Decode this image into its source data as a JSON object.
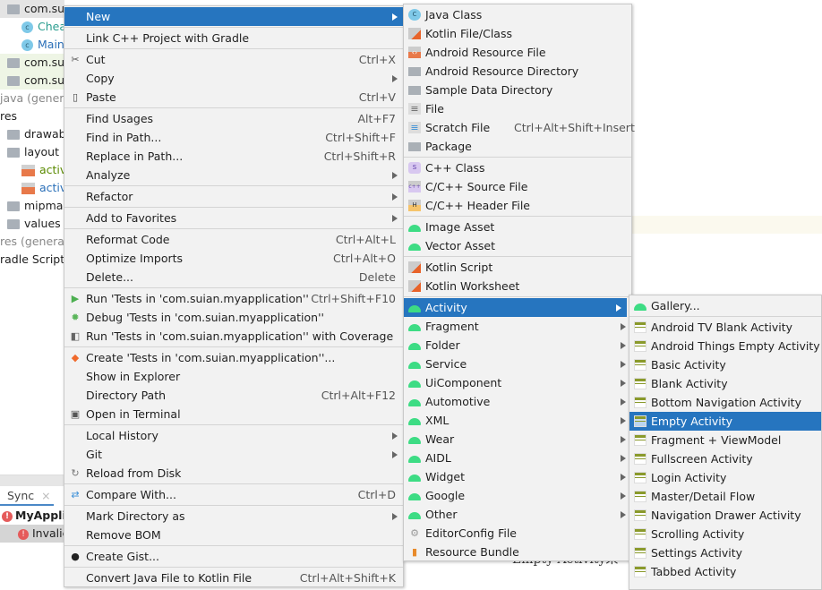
{
  "project_tree": [
    {
      "label": "com.sui",
      "icon": "folder-icon",
      "bg": "#e4e4e4",
      "color": "#1f1f1f"
    },
    {
      "label": "Chea",
      "icon": "class-icon",
      "indent": 1,
      "color": "#2a9d8f"
    },
    {
      "label": "Main",
      "icon": "class-icon",
      "indent": 1,
      "color": "#2a6fb8"
    },
    {
      "label": "com.sui",
      "icon": "folder-icon",
      "bg": "#eef5e5",
      "color": "#1f1f1f"
    },
    {
      "label": "com.sui",
      "icon": "folder-icon",
      "bg": "#eef5e5",
      "color": "#1f1f1f"
    },
    {
      "label": "java (gener",
      "icon": "",
      "color": "#1f1f1f"
    },
    {
      "label": "res",
      "icon": "",
      "color": "#1f1f1f"
    },
    {
      "label": "drawab",
      "icon": "folder-icon",
      "color": "#1f1f1f"
    },
    {
      "label": "layout",
      "icon": "folder-icon",
      "color": "#1f1f1f"
    },
    {
      "label": "activ",
      "icon": "layout-file-icon",
      "indent": 1,
      "color": "#5a8a00"
    },
    {
      "label": "activ",
      "icon": "layout-file-icon",
      "indent": 1,
      "color": "#2a6fb8"
    },
    {
      "label": "mipmap",
      "icon": "folder-icon",
      "color": "#1f1f1f"
    },
    {
      "label": "values",
      "icon": "folder-icon",
      "color": "#1f1f1f"
    },
    {
      "label": "res (genera",
      "icon": "",
      "color": "#1f1f1f"
    },
    {
      "label": "radle Scripts",
      "icon": "",
      "color": "#1f1f1f"
    }
  ],
  "bottom_panel": {
    "tab": "Sync",
    "close": "×",
    "project": "MyAppli",
    "error": "Invalic"
  },
  "behind_text": "Empty Activity来",
  "menus": [
    {
      "id": "context",
      "items": [
        {
          "label": "New",
          "submenu": true,
          "selected": true
        },
        {
          "sep": true
        },
        {
          "label": "Link C++ Project with Gradle"
        },
        {
          "sep": true
        },
        {
          "label": "Cut",
          "shortcut": "Ctrl+X",
          "icon": "scissors-icon"
        },
        {
          "label": "Copy",
          "submenu": true
        },
        {
          "label": "Paste",
          "shortcut": "Ctrl+V",
          "icon": "clipboard-icon"
        },
        {
          "sep": true
        },
        {
          "label": "Find Usages",
          "shortcut": "Alt+F7"
        },
        {
          "label": "Find in Path...",
          "shortcut": "Ctrl+Shift+F"
        },
        {
          "label": "Replace in Path...",
          "shortcut": "Ctrl+Shift+R"
        },
        {
          "label": "Analyze",
          "submenu": true
        },
        {
          "sep": true
        },
        {
          "label": "Refactor",
          "submenu": true
        },
        {
          "sep": true
        },
        {
          "label": "Add to Favorites",
          "submenu": true
        },
        {
          "sep": true
        },
        {
          "label": "Reformat Code",
          "shortcut": "Ctrl+Alt+L"
        },
        {
          "label": "Optimize Imports",
          "shortcut": "Ctrl+Alt+O"
        },
        {
          "label": "Delete...",
          "shortcut": "Delete"
        },
        {
          "sep": true
        },
        {
          "label": "Run 'Tests in 'com.suian.myapplication''",
          "shortcut": "Ctrl+Shift+F10",
          "icon": "run-icon"
        },
        {
          "label": "Debug 'Tests in 'com.suian.myapplication''",
          "icon": "debug-icon"
        },
        {
          "label": "Run 'Tests in 'com.suian.myapplication'' with Coverage",
          "icon": "coverage-icon"
        },
        {
          "sep": true
        },
        {
          "label": "Create 'Tests in 'com.suian.myapplication''...",
          "icon": "create-test-icon"
        },
        {
          "label": "Show in Explorer"
        },
        {
          "label": "Directory Path",
          "shortcut": "Ctrl+Alt+F12"
        },
        {
          "label": "Open in Terminal",
          "icon": "terminal-icon"
        },
        {
          "sep": true
        },
        {
          "label": "Local History",
          "submenu": true
        },
        {
          "label": "Git",
          "submenu": true
        },
        {
          "label": "Reload from Disk",
          "icon": "reload-icon"
        },
        {
          "sep": true
        },
        {
          "label": "Compare With...",
          "shortcut": "Ctrl+D",
          "icon": "compare-icon"
        },
        {
          "sep": true
        },
        {
          "label": "Mark Directory as",
          "submenu": true
        },
        {
          "label": "Remove BOM"
        },
        {
          "sep": true
        },
        {
          "label": "Create Gist...",
          "icon": "github-icon"
        },
        {
          "sep": true
        },
        {
          "label": "Convert Java File to Kotlin File",
          "shortcut": "Ctrl+Alt+Shift+K"
        }
      ]
    },
    {
      "id": "new",
      "items": [
        {
          "label": "Java Class",
          "icon": "java-class-icon"
        },
        {
          "label": "Kotlin File/Class",
          "icon": "kotlin-file-icon"
        },
        {
          "label": "Android Resource File",
          "icon": "resource-file-icon"
        },
        {
          "label": "Android Resource Directory",
          "icon": "folder-icon"
        },
        {
          "label": "Sample Data Directory",
          "icon": "folder-icon"
        },
        {
          "label": "File",
          "icon": "file-icon"
        },
        {
          "label": "Scratch File",
          "shortcut": "Ctrl+Alt+Shift+Insert",
          "icon": "scratch-file-icon"
        },
        {
          "label": "Package",
          "icon": "package-icon"
        },
        {
          "sep": true
        },
        {
          "label": "C++ Class",
          "icon": "cpp-class-icon"
        },
        {
          "label": "C/C++ Source File",
          "icon": "cpp-source-icon"
        },
        {
          "label": "C/C++ Header File",
          "icon": "cpp-header-icon"
        },
        {
          "sep": true
        },
        {
          "label": "Image Asset",
          "icon": "android-icon"
        },
        {
          "label": "Vector Asset",
          "icon": "android-icon"
        },
        {
          "sep": true
        },
        {
          "label": "Kotlin Script",
          "icon": "kotlin-file-icon"
        },
        {
          "label": "Kotlin Worksheet",
          "icon": "kotlin-file-icon"
        },
        {
          "sep": true
        },
        {
          "label": "Activity",
          "submenu": true,
          "selected": true,
          "icon": "android-icon"
        },
        {
          "label": "Fragment",
          "submenu": true,
          "icon": "android-icon"
        },
        {
          "label": "Folder",
          "submenu": true,
          "icon": "android-icon"
        },
        {
          "label": "Service",
          "submenu": true,
          "icon": "android-icon"
        },
        {
          "label": "UiComponent",
          "submenu": true,
          "icon": "android-icon"
        },
        {
          "label": "Automotive",
          "submenu": true,
          "icon": "android-icon"
        },
        {
          "label": "XML",
          "submenu": true,
          "icon": "android-icon"
        },
        {
          "label": "Wear",
          "submenu": true,
          "icon": "android-icon"
        },
        {
          "label": "AIDL",
          "submenu": true,
          "icon": "android-icon"
        },
        {
          "label": "Widget",
          "submenu": true,
          "icon": "android-icon"
        },
        {
          "label": "Google",
          "submenu": true,
          "icon": "android-icon"
        },
        {
          "label": "Other",
          "submenu": true,
          "icon": "android-icon"
        },
        {
          "label": "EditorConfig File",
          "icon": "gear-icon"
        },
        {
          "label": "Resource Bundle",
          "icon": "resource-bundle-icon"
        }
      ]
    },
    {
      "id": "activity",
      "items": [
        {
          "label": "Gallery...",
          "icon": "android-icon"
        },
        {
          "sep": true
        },
        {
          "label": "Android TV Blank Activity",
          "icon": "template-icon"
        },
        {
          "label": "Android Things Empty Activity",
          "icon": "template-icon"
        },
        {
          "label": "Basic Activity",
          "icon": "template-icon"
        },
        {
          "label": "Blank Activity",
          "icon": "template-icon"
        },
        {
          "label": "Bottom Navigation Activity",
          "icon": "template-icon"
        },
        {
          "label": "Empty Activity",
          "icon": "template-icon",
          "selected": true
        },
        {
          "label": "Fragment + ViewModel",
          "icon": "template-icon"
        },
        {
          "label": "Fullscreen Activity",
          "icon": "template-icon"
        },
        {
          "label": "Login Activity",
          "icon": "template-icon"
        },
        {
          "label": "Master/Detail Flow",
          "icon": "template-icon"
        },
        {
          "label": "Navigation Drawer Activity",
          "icon": "template-icon"
        },
        {
          "label": "Scrolling Activity",
          "icon": "template-icon"
        },
        {
          "label": "Settings Activity",
          "icon": "template-icon"
        },
        {
          "label": "Tabbed Activity",
          "icon": "template-icon"
        }
      ]
    }
  ],
  "colors": {
    "selection": "#2675bf",
    "menu_bg": "#f2f2f2",
    "android": "#3ddc84"
  }
}
